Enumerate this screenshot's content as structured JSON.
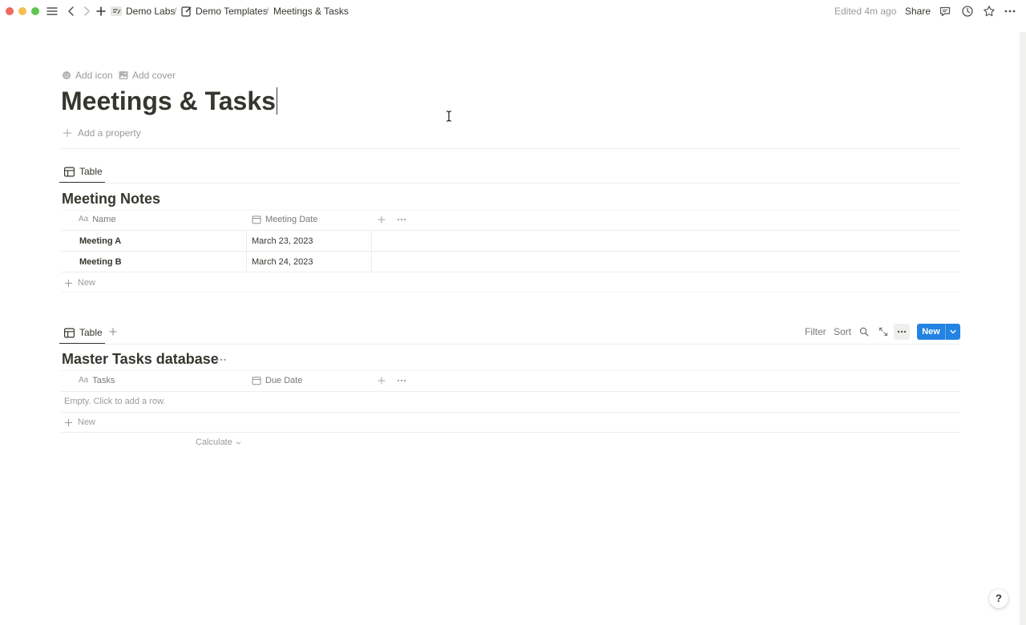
{
  "window": {
    "traffic_colors": [
      "#ec6a5e",
      "#f4bf4f",
      "#61c554"
    ]
  },
  "breadcrumb": {
    "items": [
      "Demo Labs",
      "Demo Templates",
      "Meetings & Tasks"
    ],
    "separator": "/"
  },
  "topbar": {
    "edited": "Edited 4m ago",
    "share": "Share"
  },
  "page": {
    "add_icon": "Add icon",
    "add_cover": "Add cover",
    "title": "Meetings & Tasks",
    "add_property": "Add a property"
  },
  "db1": {
    "tab": "Table",
    "title": "Meeting Notes",
    "columns": [
      "Name",
      "Meeting Date"
    ],
    "rows": [
      {
        "name": "Meeting A",
        "date": "March 23, 2023"
      },
      {
        "name": "Meeting B",
        "date": "March 24, 2023"
      }
    ],
    "new_label": "New"
  },
  "db2": {
    "tab": "Table",
    "title": "Master Tasks database",
    "columns": [
      "Tasks",
      "Due Date"
    ],
    "empty": "Empty. Click to add a row.",
    "new_label": "New",
    "calculate": "Calculate"
  },
  "toolbar": {
    "filter": "Filter",
    "sort": "Sort",
    "new": "New"
  },
  "help": "?",
  "colors": {
    "accent": "#2383e2",
    "text": "#37352f",
    "muted": "#9b9a97"
  }
}
